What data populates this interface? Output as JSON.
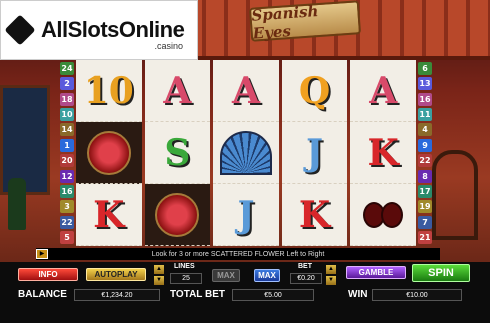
{
  "logo": {
    "name": "AllSlotsOnline",
    "suffix": ".casino"
  },
  "game_title": "Spanish Eyes",
  "paylines_left": [
    "24",
    "2",
    "18",
    "10",
    "14",
    "1",
    "20",
    "12",
    "16",
    "3",
    "22",
    "5"
  ],
  "paylines_right": [
    "6",
    "13",
    "16",
    "11",
    "4",
    "9",
    "22",
    "8",
    "17",
    "19",
    "7",
    "21"
  ],
  "payline_colors": [
    "#3a8a3a",
    "#5a5adc",
    "#b04a8a",
    "#3aa0a0",
    "#8a6a2a",
    "#2a6adc",
    "#b03a3a",
    "#6a2ab0",
    "#2a8a6a",
    "#a08a2a",
    "#3a5aa0",
    "#c04040"
  ],
  "reels": [
    [
      {
        "t": "10",
        "c": "#e8a020",
        "kind": "text"
      },
      {
        "t": "",
        "c": "",
        "kind": "flower"
      },
      {
        "t": "K",
        "c": "#d8262a",
        "kind": "text"
      }
    ],
    [
      {
        "t": "A",
        "c": "#d84a6a",
        "kind": "text"
      },
      {
        "t": "S",
        "c": "#3aa83a",
        "kind": "text"
      },
      {
        "t": "",
        "c": "",
        "kind": "flower"
      }
    ],
    [
      {
        "t": "A",
        "c": "#d84a6a",
        "kind": "text"
      },
      {
        "t": "",
        "c": "",
        "kind": "fan"
      },
      {
        "t": "J",
        "c": "#5a9ad8",
        "kind": "text"
      }
    ],
    [
      {
        "t": "Q",
        "c": "#f0a020",
        "kind": "text"
      },
      {
        "t": "J",
        "c": "#5a9ad8",
        "kind": "text"
      },
      {
        "t": "K",
        "c": "#d8262a",
        "kind": "text"
      }
    ],
    [
      {
        "t": "A",
        "c": "#d84a6a",
        "kind": "text"
      },
      {
        "t": "K",
        "c": "#d8262a",
        "kind": "text"
      },
      {
        "t": "",
        "c": "",
        "kind": "castanets"
      }
    ]
  ],
  "message": "Look for 3 or more SCATTERED FLOWER Left to Right",
  "controls": {
    "info": "INFO",
    "autoplay": "AUTOPLAY",
    "lines_label": "LINES",
    "lines_value": "25",
    "max_lines": "MAX",
    "max_bet": "MAX",
    "bet_label": "BET",
    "bet_value": "€0.20",
    "gamble": "GAMBLE",
    "spin": "SPIN"
  },
  "balance": {
    "label": "BALANCE",
    "value": "€1,234.20"
  },
  "total_bet": {
    "label": "TOTAL BET",
    "value": "€5.00"
  },
  "win": {
    "label": "WIN",
    "value": "€10.00"
  }
}
